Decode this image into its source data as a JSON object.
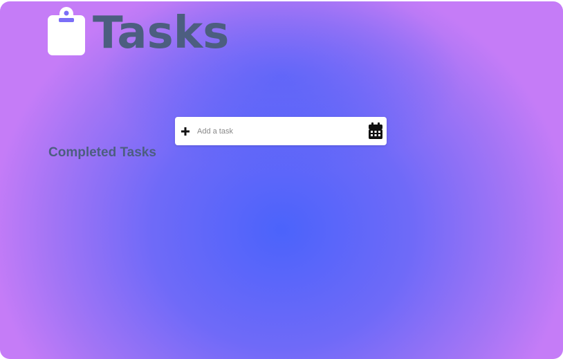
{
  "app": {
    "title": "Tasks",
    "title_icon": "clipboard-icon"
  },
  "add_task": {
    "placeholder": "Add a task",
    "value": "",
    "add_icon": "plus-icon",
    "date_icon": "calendar-icon"
  },
  "completed": {
    "heading": "Completed Tasks"
  },
  "colors": {
    "title_text": "#4c5e80",
    "background_center": "#4b63fb",
    "background_edge": "#c57cf7"
  }
}
